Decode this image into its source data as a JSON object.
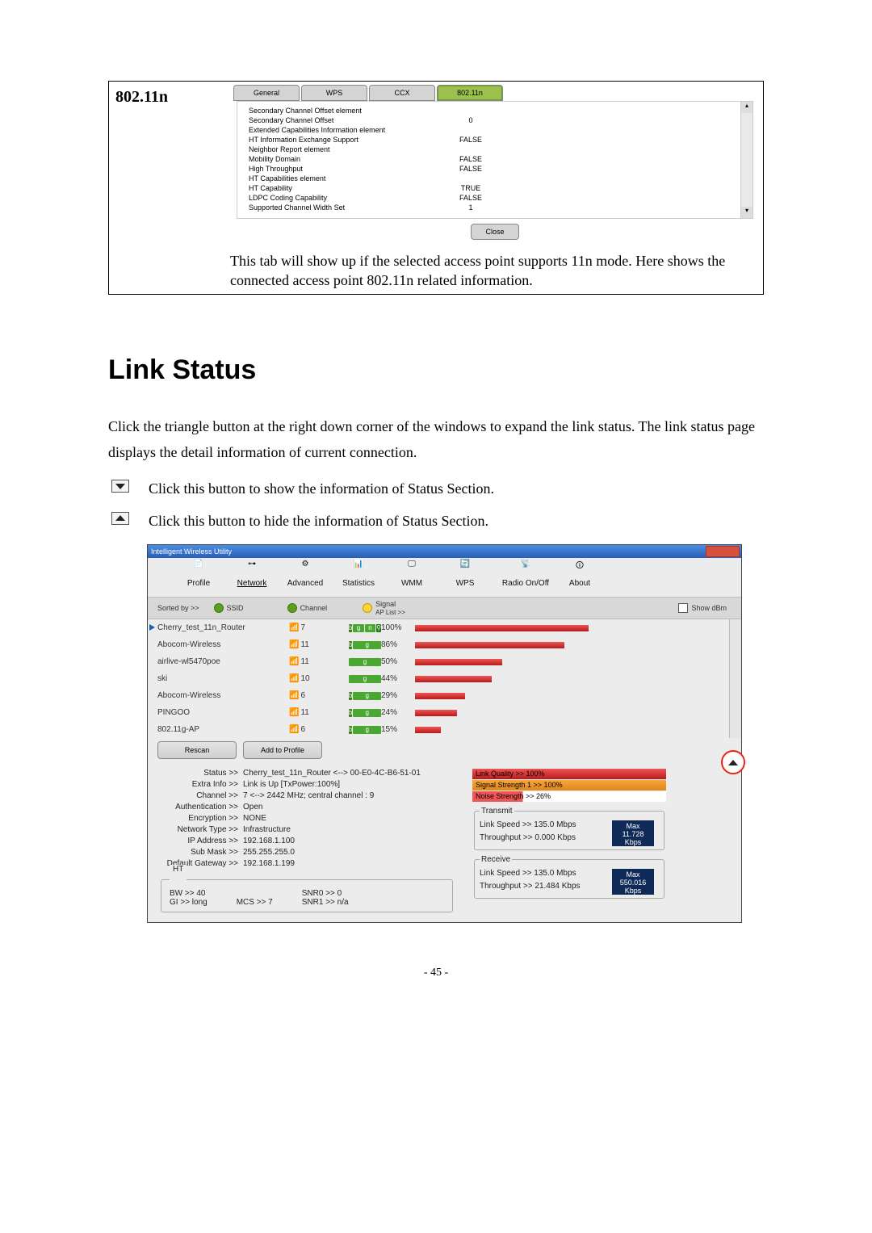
{
  "panel_802": {
    "header": "802.11n",
    "tabs": [
      "General",
      "WPS",
      "CCX",
      "802.11n"
    ],
    "close": "Close",
    "rows": [
      {
        "l": "Secondary Channel Offset element",
        "v": ""
      },
      {
        "l": "Secondary Channel Offset",
        "v": "0"
      },
      {
        "l": "Extended Capabilities Information element",
        "v": ""
      },
      {
        "l": "HT Information Exchange Support",
        "v": "FALSE"
      },
      {
        "l": "Neighbor Report element",
        "v": ""
      },
      {
        "l": "Mobility Domain",
        "v": "FALSE"
      },
      {
        "l": "High Throughput",
        "v": "FALSE"
      },
      {
        "l": "HT Capabilities element",
        "v": ""
      },
      {
        "l": "HT Capability",
        "v": "TRUE"
      },
      {
        "l": "LDPC Coding Capability",
        "v": "FALSE"
      },
      {
        "l": "Supported Channel Width Set",
        "v": "1"
      }
    ],
    "desc": "This tab will show up if the selected access point supports 11n mode. Here shows the connected access point 802.11n related information."
  },
  "section_title": "Link Status",
  "intro": "Click the triangle button at the right down corner of the windows to expand the link status. The link status page displays the detail information of current connection.",
  "bullets": [
    "Click this button to show the information of Status Section.",
    "Click this button to hide the information of Status Section."
  ],
  "app": {
    "title": "Intelligent Wireless Utility",
    "toolbar": [
      "Profile",
      "Network",
      "Advanced",
      "Statistics",
      "WMM",
      "WPS",
      "Radio On/Off",
      "About"
    ],
    "sortbar": {
      "sortby": "Sorted by >>",
      "c1": "SSID",
      "c2": "Channel",
      "c3": "Signal",
      "aplist": "AP List >>",
      "showdbm": "Show dBm"
    },
    "ap": [
      {
        "ssid": "Cherry_test_11n_Router",
        "ch": "7",
        "icons": "bgnw",
        "sig": 100
      },
      {
        "ssid": "Abocom-Wireless",
        "ch": "11",
        "icons": "bg",
        "sig": 86
      },
      {
        "ssid": "airlive-wl5470poe",
        "ch": "11",
        "icons": "g",
        "sig": 50
      },
      {
        "ssid": "ski",
        "ch": "10",
        "icons": "g",
        "sig": 44
      },
      {
        "ssid": "Abocom-Wireless",
        "ch": "6",
        "icons": "bg",
        "sig": 29
      },
      {
        "ssid": "PINGOO",
        "ch": "11",
        "icons": "bg",
        "sig": 24
      },
      {
        "ssid": "802.11g-AP",
        "ch": "6",
        "icons": "bg",
        "sig": 15
      }
    ],
    "buttons": {
      "rescan": "Rescan",
      "add": "Add to Profile"
    },
    "status": {
      "labels": [
        "Status >>",
        "Extra Info >>",
        "Channel >>",
        "Authentication >>",
        "Encryption >>",
        "Network Type >>",
        "IP Address >>",
        "Sub Mask >>",
        "Default Gateway >>"
      ],
      "values": [
        "Cherry_test_11n_Router <--> 00-E0-4C-B6-51-01",
        "Link is Up [TxPower:100%]",
        "7 <--> 2442 MHz; central channel : 9",
        "Open",
        "NONE",
        "Infrastructure",
        "192.168.1.100",
        "255.255.255.0",
        "192.168.1.199"
      ]
    },
    "meters": {
      "lq": "Link Quality >> 100%",
      "ss": "Signal Strength 1 >> 100%",
      "ns": "Noise Strength >> 26%"
    },
    "tx": {
      "hdr": "Transmit",
      "ls": "Link Speed >> 135.0 Mbps",
      "tp": "Throughput >> 0.000 Kbps",
      "max": "Max",
      "mv": "11.728",
      "unit": "Kbps"
    },
    "rx": {
      "hdr": "Receive",
      "ls": "Link Speed >> 135.0 Mbps",
      "tp": "Throughput >> 21.484 Kbps",
      "max": "Max",
      "mv": "550.016",
      "unit": "Kbps"
    },
    "ht": {
      "hdr": "HT",
      "bw": "BW >> 40",
      "gi": "GI >> long",
      "mcs": "MCS >>  7",
      "snr0": "SNR0 >>  0",
      "snr1": "SNR1 >>  n/a"
    }
  },
  "page_no": "- 45 -"
}
